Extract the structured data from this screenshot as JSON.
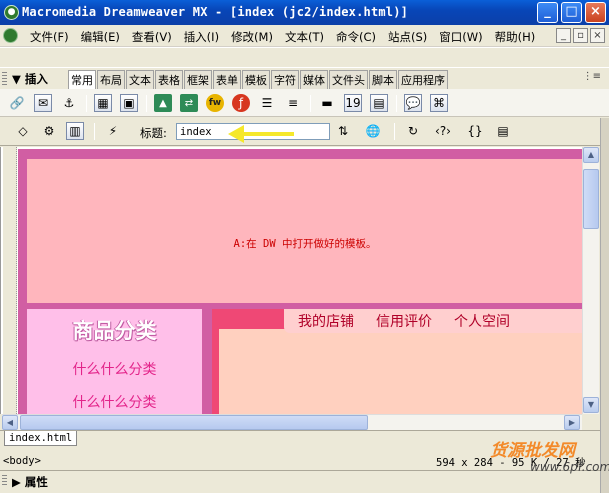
{
  "window": {
    "title": "Macromedia Dreamweaver MX - [index (jc2/index.html)]",
    "minimize": "_",
    "maximize": "□",
    "close": "×"
  },
  "menubar": {
    "items": [
      "文件(F)",
      "编辑(E)",
      "查看(V)",
      "插入(I)",
      "修改(M)",
      "文本(T)",
      "命令(C)",
      "站点(S)",
      "窗口(W)",
      "帮助(H)"
    ],
    "mdi": [
      "_",
      "▫",
      "×"
    ]
  },
  "insert_panel": {
    "title": "▼ 插入",
    "tabs": [
      "常用",
      "布局",
      "文本",
      "表格",
      "框架",
      "表单",
      "模板",
      "字符",
      "媒体",
      "文件头",
      "脚本",
      "应用程序"
    ],
    "active_tab": "常用",
    "options": "⋮≡"
  },
  "doc_toolbar": {
    "title_label": "标题:",
    "title_value": "index"
  },
  "design": {
    "note": "A:在 DW 中打开做好的模板。",
    "category_heading": "商品分类",
    "category_items": [
      "什么什么分类",
      "什么什么分类"
    ],
    "nav_links": [
      "我的店铺",
      "信用评价",
      "个人空间"
    ]
  },
  "document_tab": "index.html",
  "status": {
    "tag": "<body>",
    "dims": "594 x 284 - 95 K / 27 秒"
  },
  "properties_panel": {
    "title": "▶ 属性"
  },
  "watermark": {
    "line1": "货源批发网",
    "line2": "www.6pf.com"
  },
  "colors": {
    "titlebar": "#0846b8",
    "page_border": "#d15ea3",
    "header_bg": "#ffb6bd",
    "sidebar_bg": "#ffbfe9",
    "content_border": "#ef4875",
    "content_bg": "#ffd0bf",
    "note_color": "#cc0000",
    "arrow": "#f5e82a"
  }
}
